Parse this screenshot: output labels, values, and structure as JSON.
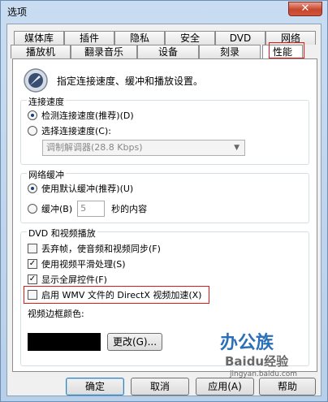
{
  "window": {
    "title": "选项",
    "close_glyph": "✕"
  },
  "tabs": {
    "row1": [
      "媒体库",
      "插件",
      "隐私",
      "安全",
      "DVD",
      "网络"
    ],
    "row2": [
      "播放机",
      "翻录音乐",
      "设备",
      "刻录",
      "性能"
    ]
  },
  "intro_text": "指定连接速度、缓冲和播放设置。",
  "connection": {
    "legend": "连接速度",
    "detect_label": "检测连接速度(推荐)(D)",
    "choose_label": "选择连接速度(C):",
    "combo_value": "调制解调器(28.8 Kbps)"
  },
  "buffer": {
    "legend": "网络缓冲",
    "default_label": "使用默认缓冲(推荐)(U)",
    "buffer_label": "缓冲(B)",
    "seconds_value": "5",
    "seconds_suffix": "秒的内容"
  },
  "dvd": {
    "legend": "DVD 和视频播放",
    "drop_frames": "丢弃帧，使音频和视频同步(F)",
    "smoothing": "使用视频平滑处理(S)",
    "fullscreen": "显示全屏控件(F)",
    "directx": "启用 WMV 文件的 DirectX 视频加速(X)",
    "border_color_label": "视频边框颜色:",
    "change_button": "更改(G)..."
  },
  "buttons": {
    "ok": "确定",
    "cancel": "取消",
    "apply": "应用(A)",
    "help": "帮助"
  },
  "watermark": {
    "brand": "办公族",
    "site": "Baidu经验",
    "url": "jingyan.baidu.com"
  }
}
